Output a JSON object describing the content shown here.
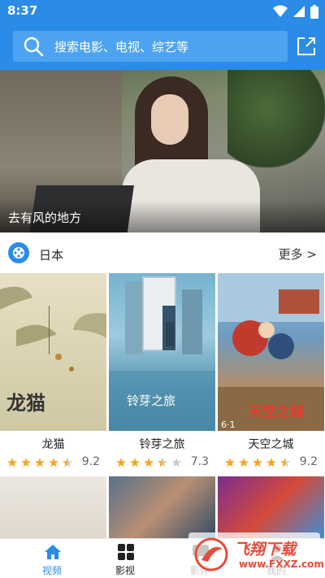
{
  "status_bar": {
    "time": "8:37"
  },
  "header": {
    "search_placeholder": "搜索电影、电视、综艺等",
    "share_icon": "share-icon"
  },
  "banner": {
    "title": "去有风的地方"
  },
  "section": {
    "title": "日本",
    "more": "更多 >"
  },
  "movies": [
    {
      "title": "龙猫",
      "score": "9.2",
      "stars": 4.5
    },
    {
      "title": "铃芽之旅",
      "score": "7.3",
      "stars": 3.5
    },
    {
      "title": "天空之城",
      "score": "9.2",
      "stars": 4.5
    }
  ],
  "posters": {
    "totoro_text": "龙猫",
    "suzume_text": "铃芽之旅",
    "laputa_text": "天空之城",
    "laputa_date": "6·1"
  },
  "nav": [
    {
      "label": "视频",
      "active": true
    },
    {
      "label": "影视",
      "active": false
    },
    {
      "label": "影评",
      "active": false
    },
    {
      "label": "我的",
      "active": false
    }
  ],
  "watermark": {
    "brand": "飞翔下载",
    "url": "www.FXXZ.com"
  },
  "colors": {
    "accent": "#2b8ce8",
    "star": "#f5a623",
    "search_bg": "#4ea3f1"
  }
}
